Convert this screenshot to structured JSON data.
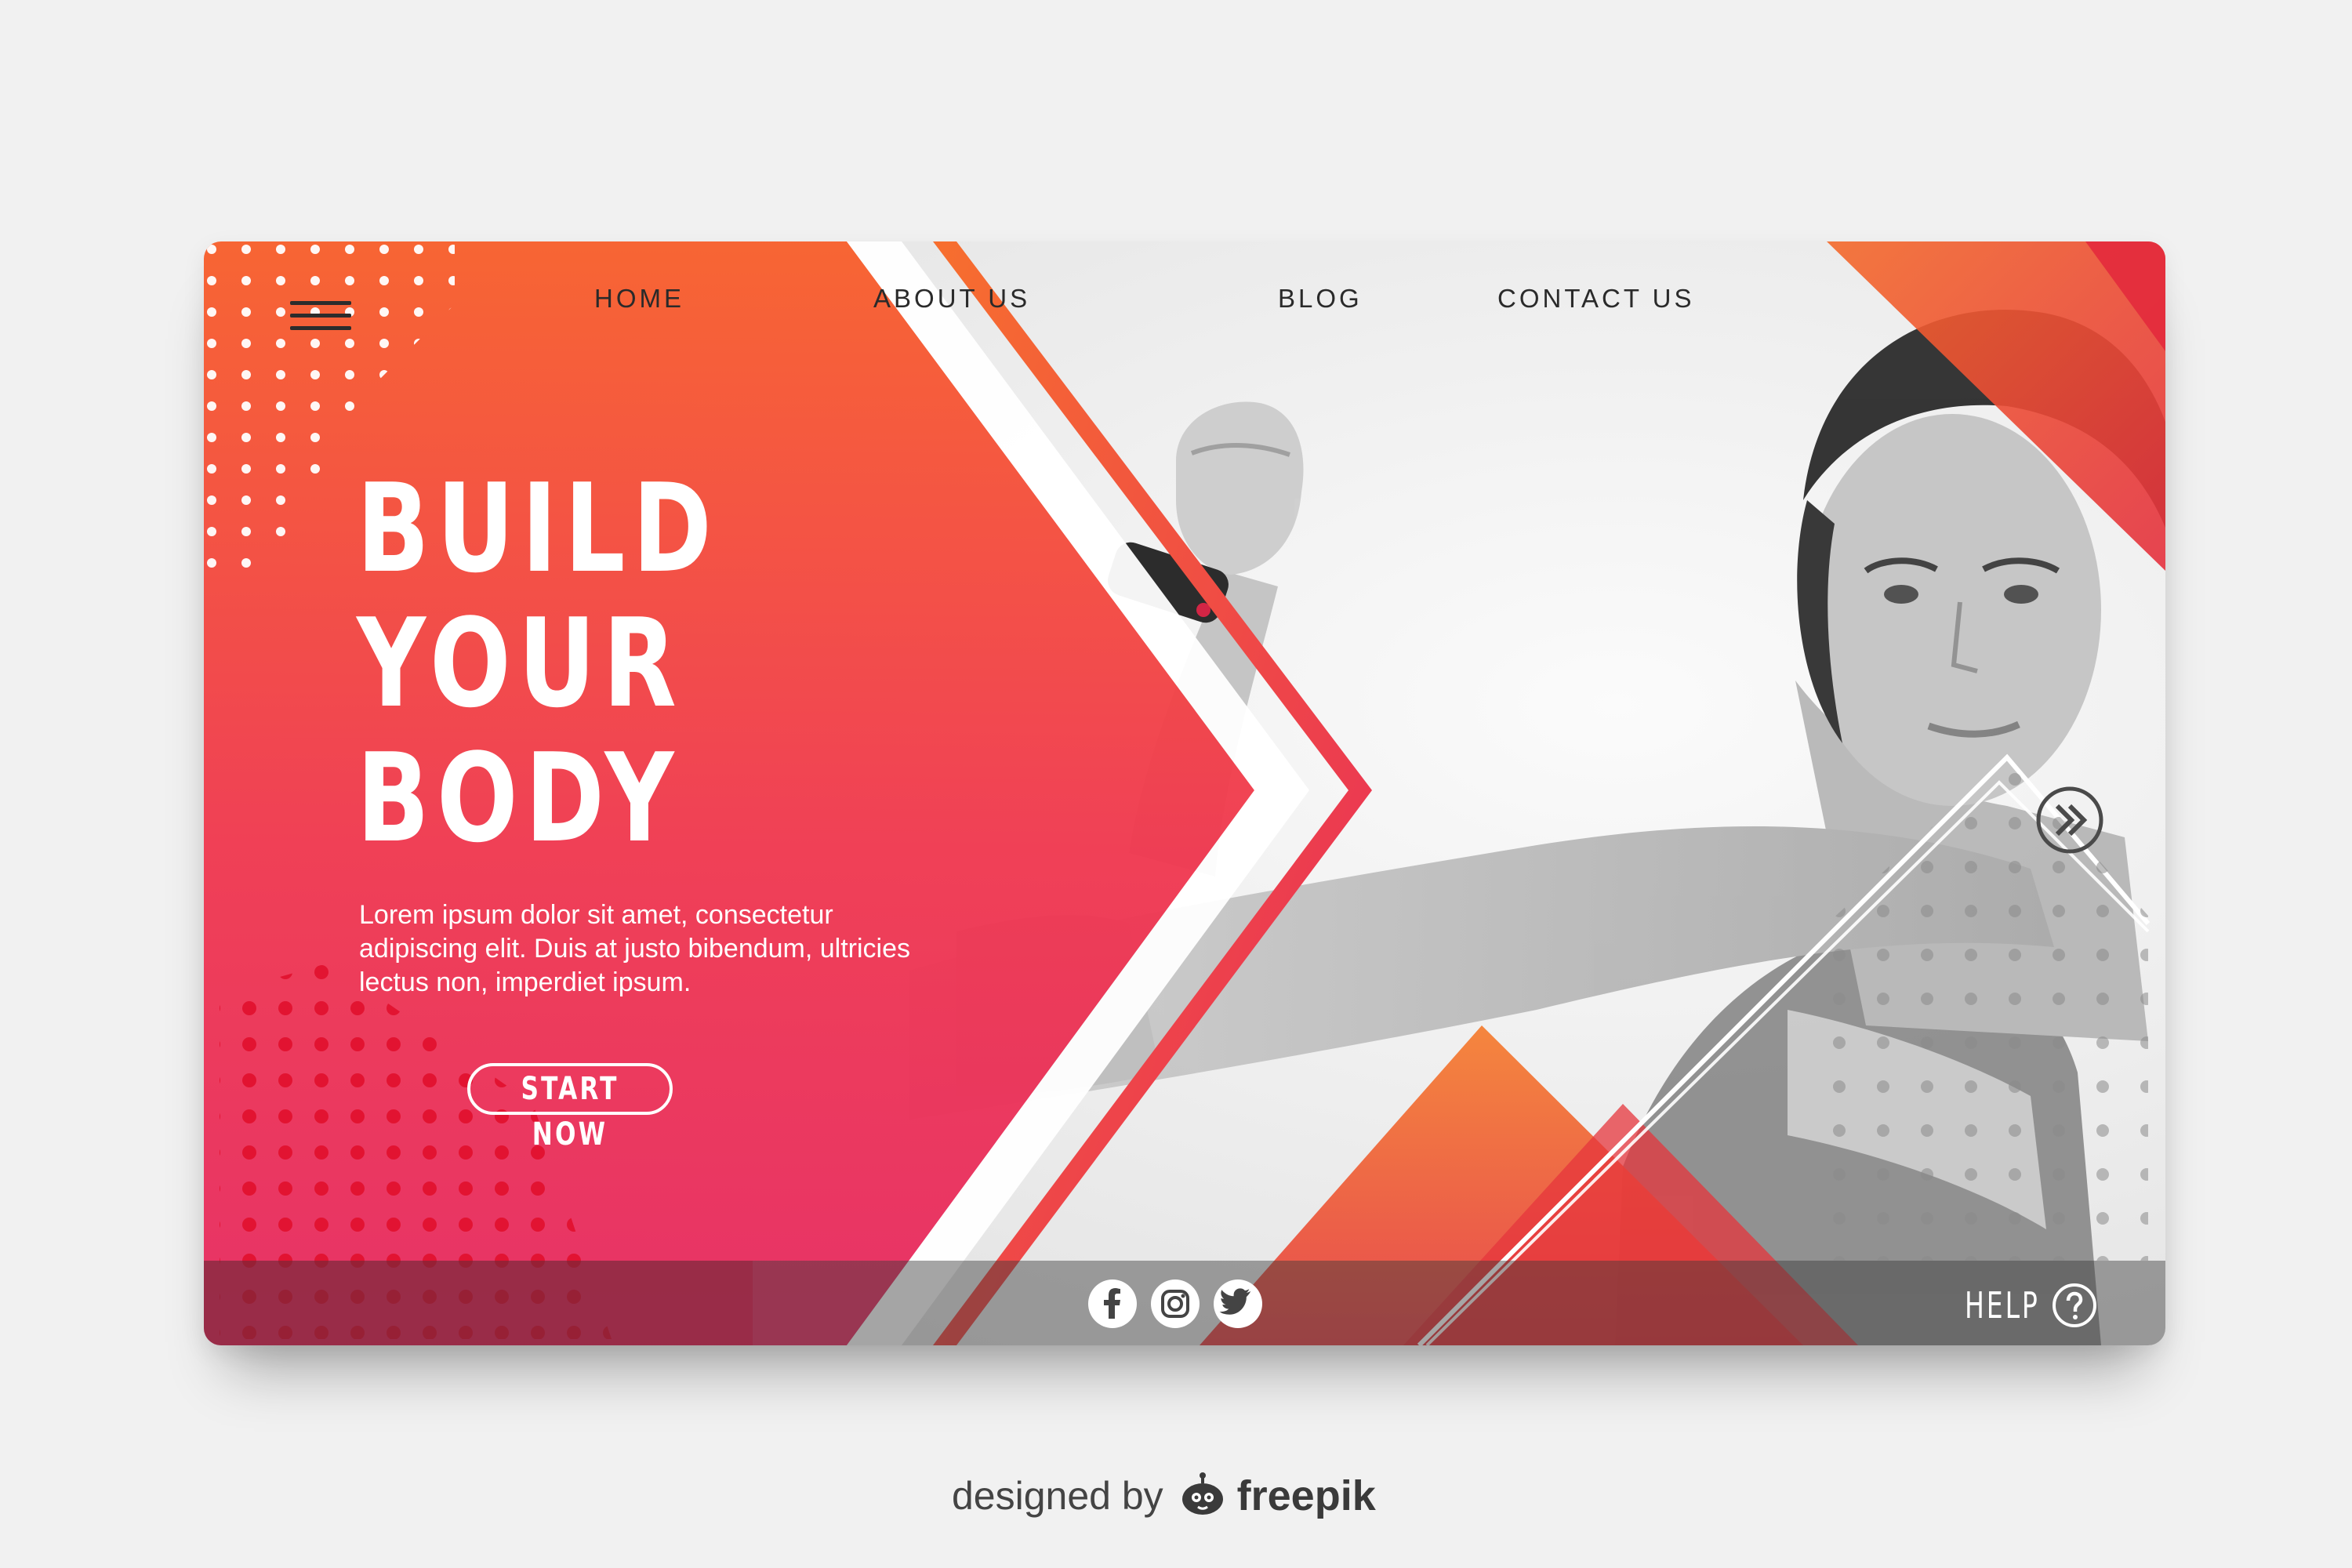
{
  "nav": {
    "menu_icon": "hamburger-icon",
    "links": [
      "HOME",
      "ABOUT US",
      "BLOG",
      "CONTACT US"
    ]
  },
  "hero": {
    "title_lines": [
      "BUILD",
      "YOUR",
      "BODY"
    ],
    "body": "Lorem ipsum dolor sit amet, consectetur adipiscing elit. Duis at justo bibendum, ultricies lectus non, imperdiet ipsum.",
    "cta_label": "START NOW"
  },
  "footer": {
    "social_icons": [
      "facebook-icon",
      "instagram-icon",
      "twitter-icon"
    ],
    "help_label": "HELP",
    "help_icon": "question-circle-icon"
  },
  "next_icon": "double-chevron-right-icon",
  "credit": {
    "prefix": "designed by",
    "brand": "freepik"
  },
  "colors": {
    "accent_orange": "#f7552f",
    "accent_pink": "#ec2b5d",
    "accent_red": "#e2253f",
    "text_dark": "#2a2a2a",
    "background": "#f1f1f1"
  }
}
